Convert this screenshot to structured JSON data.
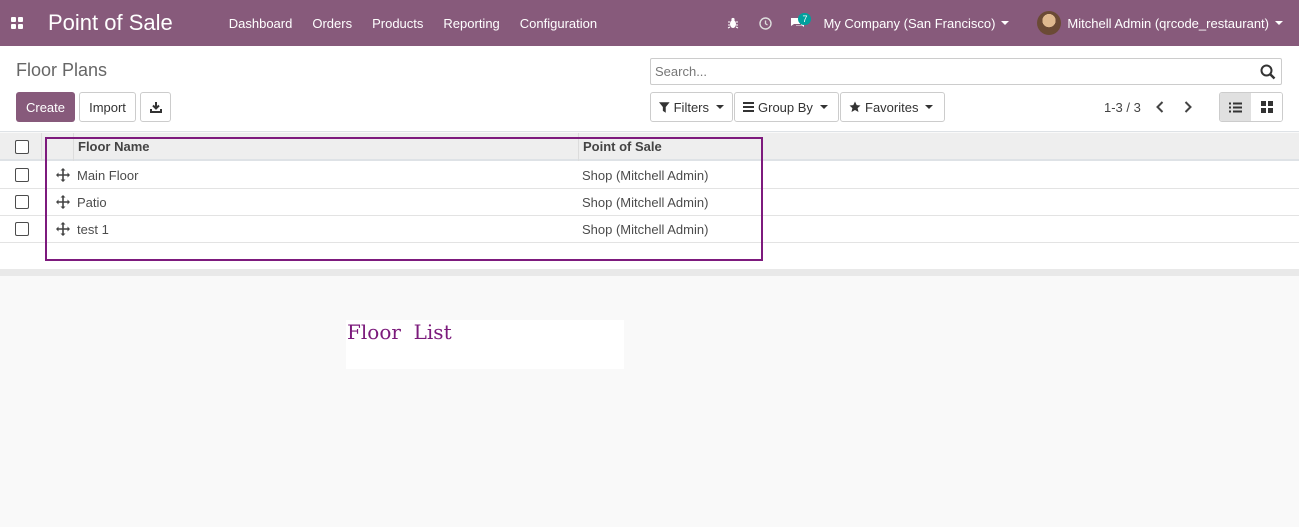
{
  "navbar": {
    "app_title": "Point of Sale",
    "menu": [
      "Dashboard",
      "Orders",
      "Products",
      "Reporting",
      "Configuration"
    ],
    "messages_badge": "7",
    "company": "My Company (San Francisco)",
    "user": "Mitchell Admin (qrcode_restaurant)",
    "icons": [
      "apps-icon",
      "bug-icon",
      "clock-icon",
      "chat-icon"
    ]
  },
  "control_panel": {
    "breadcrumb": "Floor Plans",
    "create_label": "Create",
    "import_label": "Import",
    "search_placeholder": "Search...",
    "filters_label": "Filters",
    "groupby_label": "Group By",
    "favorites_label": "Favorites",
    "pager": "1-3 / 3"
  },
  "list": {
    "columns": [
      "Floor Name",
      "Point of Sale"
    ],
    "rows": [
      {
        "floor_name": "Main Floor",
        "point_of_sale": "Shop (Mitchell Admin)"
      },
      {
        "floor_name": "Patio",
        "point_of_sale": "Shop (Mitchell Admin)"
      },
      {
        "floor_name": "test 1",
        "point_of_sale": "Shop (Mitchell Admin)"
      }
    ]
  },
  "caption": "Floor  List",
  "colors": {
    "navbar": "#875a7b",
    "highlight": "#7d1a7d",
    "caption_text": "#7b1a7b"
  }
}
